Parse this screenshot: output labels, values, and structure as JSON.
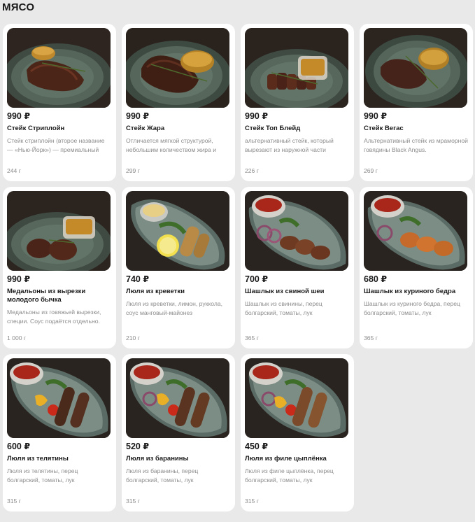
{
  "section": {
    "title": "МЯСО"
  },
  "products": [
    {
      "price": "990 ₽",
      "name": "Стейк Стриплойн",
      "desc": "Стейк стриплойн (второе название — «Нью-Йорк») — премиальный",
      "weight": "244 г",
      "image": "steak-plate"
    },
    {
      "price": "990 ₽",
      "name": "Стейк Жара",
      "desc": "Отличается мягкой структурой, небольшим количеством жира и",
      "weight": "299 г",
      "image": "steak-plate"
    },
    {
      "price": "990 ₽",
      "name": "Стейк Топ Блейд",
      "desc": "альтернативный стейк, который вырезают из наружной части",
      "weight": "226 г",
      "image": "sliced-steak-plate"
    },
    {
      "price": "990 ₽",
      "name": "Стейк Вегас",
      "desc": "Альтернативный стейк из мраморной говядины Black Angus.",
      "weight": "269 г",
      "image": "steak-plate"
    },
    {
      "price": "990 ₽",
      "name": "Медальоны из вырезки молодого бычка",
      "desc": "Медальоны из говяжьей вырезки, специи. Соус подаётся отдельно.",
      "weight": "1 000 г",
      "image": "medallions-plate"
    },
    {
      "price": "740 ₽",
      "name": "Люля из креветки",
      "desc": "Люля из креветки, лимон, руккола, соус манговый-майонез",
      "weight": "210 г",
      "image": "shrimp-kebab-plate"
    },
    {
      "price": "700 ₽",
      "name": "Шашлык из свиной шеи",
      "desc": "Шашлык из свинины, перец болгарский, томаты, лук",
      "weight": "365 г",
      "image": "pork-shashlik-plate"
    },
    {
      "price": "680 ₽",
      "name": "Шашлык из куриного бедра",
      "desc": "Шашлык из куриного бедра, перец болгарский, томаты, лук",
      "weight": "365 г",
      "image": "chicken-shashlik-plate"
    },
    {
      "price": "600 ₽",
      "name": "Люля из телятины",
      "desc": "Люля из телятины, перец болгарский, томаты, лук",
      "weight": "315 г",
      "image": "kebab-plate"
    },
    {
      "price": "520 ₽",
      "name": "Люля из баранины",
      "desc": "Люля из баранины, перец болгарский, томаты, лук",
      "weight": "315 г",
      "image": "kebab-plate"
    },
    {
      "price": "450 ₽",
      "name": "Люля из филе цыплёнка",
      "desc": "Люля из филе цыплёнка, перец болгарский, томаты, лук",
      "weight": "315 г",
      "image": "kebab-plate"
    }
  ]
}
